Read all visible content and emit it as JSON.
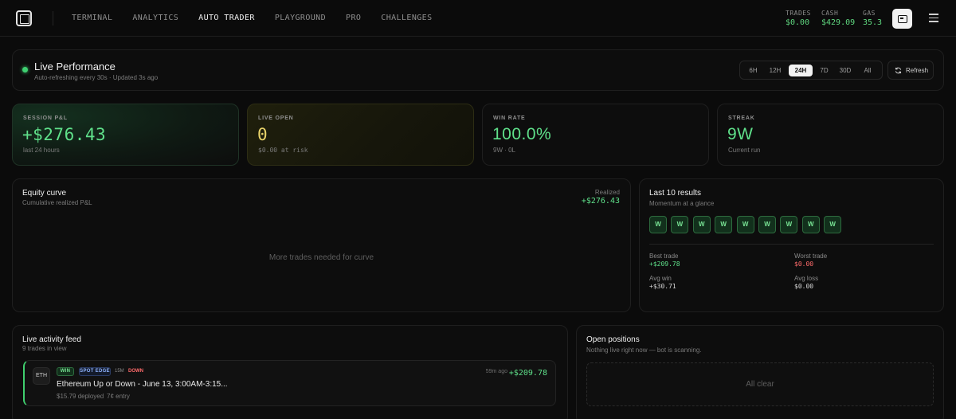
{
  "nav": {
    "items": [
      {
        "label": "TERMINAL",
        "active": false
      },
      {
        "label": "ANALYTICS",
        "active": false
      },
      {
        "label": "AUTO TRADER",
        "active": true
      },
      {
        "label": "PLAYGROUND",
        "active": false
      },
      {
        "label": "PRO",
        "active": false
      },
      {
        "label": "CHALLENGES",
        "active": false
      }
    ],
    "stats": [
      {
        "label": "TRADES",
        "value": "$0.00"
      },
      {
        "label": "CASH",
        "value": "$429.09"
      },
      {
        "label": "GAS",
        "value": "35.3"
      }
    ],
    "icons": {
      "logo": "logo-icon",
      "wallet": "wallet-icon",
      "menu": "hamburger-menu-icon"
    }
  },
  "header": {
    "title": "Live Performance",
    "subtitle": "Auto-refreshing every 30s · Updated 3s ago",
    "ranges": [
      {
        "label": "6H",
        "active": false
      },
      {
        "label": "12H",
        "active": false
      },
      {
        "label": "24H",
        "active": true
      },
      {
        "label": "7D",
        "active": false
      },
      {
        "label": "30D",
        "active": false
      },
      {
        "label": "All",
        "active": false
      }
    ],
    "refresh_label": "Refresh"
  },
  "kpis": [
    {
      "label": "SESSION P&L",
      "value": "+$276.43",
      "sub": "last 24 hours",
      "color": "#5fe08a"
    },
    {
      "label": "LIVE OPEN",
      "value": "0",
      "sub": "$0.00 at risk",
      "color": "#e9d36a"
    },
    {
      "label": "WIN RATE",
      "value": "100.0%",
      "sub": "9W · 0L",
      "color": "#5fe08a"
    },
    {
      "label": "STREAK",
      "value": "9W",
      "sub": "Current run",
      "color": "#5fe08a"
    }
  ],
  "equity": {
    "title": "Equity curve",
    "subtitle": "Cumulative realized P&L",
    "realized_label": "Realized",
    "realized_value": "+$276.43",
    "empty_text": "More trades needed for curve"
  },
  "results": {
    "title": "Last 10 results",
    "subtitle": "Momentum at a glance",
    "outcomes": [
      "W",
      "W",
      "W",
      "W",
      "W",
      "W",
      "W",
      "W",
      "W"
    ],
    "metrics": {
      "best_label": "Best trade",
      "best_value": "+$209.78",
      "worst_label": "Worst trade",
      "worst_value": "$0.00",
      "avg_win_label": "Avg win",
      "avg_win_value": "+$30.71",
      "avg_loss_label": "Avg loss",
      "avg_loss_value": "$0.00"
    }
  },
  "feed": {
    "title": "Live activity feed",
    "subtitle": "9 trades in view",
    "items": [
      {
        "token": "ETH",
        "result": "WIN",
        "strategy": "SPOT EDGE",
        "timeframe": "15M",
        "direction": "DOWN",
        "market": "Ethereum Up or Down - June 13, 3:00AM-3:15...",
        "deployed": "$15.79 deployed",
        "entry": "7¢ entry",
        "time_ago": "59m ago",
        "pnl": "+$209.78"
      }
    ]
  },
  "positions": {
    "title": "Open positions",
    "subtitle": "Nothing live right now — bot is scanning.",
    "empty_text": "All clear"
  },
  "colors": {
    "green": "#5fe08a",
    "red": "#ff6b6b",
    "amber": "#e9d36a",
    "bg": "#0b0b0b"
  }
}
